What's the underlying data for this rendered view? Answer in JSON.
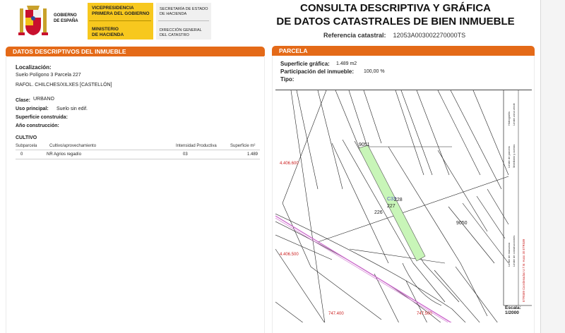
{
  "header": {
    "gov_line1": "GOBIERNO",
    "gov_line2": "DE ESPAÑA",
    "vice_line1": "VICEPRESIDENCIA",
    "vice_line2": "PRIMERA DEL GOBIERNO",
    "min_line1": "MINISTERIO",
    "min_line2": "DE HACIENDA",
    "sec_line1": "SECRETARÍA DE ESTADO",
    "sec_line2": "DE HACIENDA",
    "dg_line1": "DIRECCIÓN GENERAL",
    "dg_line2": "DEL CATASTRO",
    "title_line1": "CONSULTA DESCRIPTIVA Y GRÁFICA",
    "title_line2": "DE DATOS CATASTRALES DE BIEN INMUEBLE",
    "ref_label": "Referencia catastral:",
    "ref_value": "12053A003002270000TS"
  },
  "left": {
    "section_title": "DATOS DESCRIPTIVOS DEL INMUEBLE",
    "localizacion_label": "Localización:",
    "loc_line1": "Suelo Polígono 3 Parcela 227",
    "loc_line2": "RAFOL. CHILCHES/XILXES [CASTELLÓN]",
    "clase_label": "Clase:",
    "clase_value": "URBANO",
    "uso_label": "Uso principal:",
    "uso_value": "Suelo sin edif.",
    "superficie_label": "Superficie construida:",
    "anio_label": "Año construcción:",
    "cultivo_title": "CULTIVO",
    "table_headers": [
      "Subparcela",
      "Cultivo/aprovechamiento",
      "Intensidad Productiva",
      "Superficie m²"
    ],
    "table_row": [
      "0",
      "NR Agrios regadío",
      "03",
      "1.489"
    ]
  },
  "right": {
    "section_title": "PARCELA",
    "sup_label": "Superficie gráfica:",
    "sup_value": "1.489 m2",
    "part_label": "Participación del inmueble:",
    "part_value": "100,00 %",
    "tipo_label": "Tipo:"
  },
  "map": {
    "labels": [
      "9051",
      "4.406.600",
      "C33",
      "228",
      "227",
      "226",
      "9050",
      "4.406.500",
      "747.400",
      "747.500"
    ],
    "legend_right": [
      "Límite de parcela",
      "Límite de manzana",
      "Límite de construcciones",
      "Hidrografía",
      "Mobiliario y aceras",
      "Límite zona verde"
    ],
    "coordinates_note": "ETRS89 Coordenadas U.T.M. Huso 30 ETRS89",
    "escala_label": "Escala:",
    "escala_value": "1/2000"
  },
  "colors": {
    "section_header": "#e46a18",
    "parcel_fill": "#c8f5b8",
    "road": "#cc66cc",
    "coord_text": "#cc2222"
  }
}
